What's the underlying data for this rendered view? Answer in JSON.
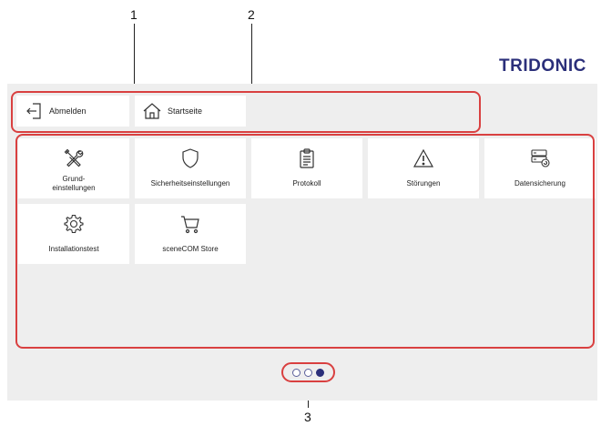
{
  "callouts": [
    "1",
    "2",
    "3"
  ],
  "brand": {
    "logo_text": "TRIDONIC",
    "color": "#2b2f7a"
  },
  "accent": "#d94040",
  "quick_actions": [
    {
      "label": "Abmelden",
      "icon": "logout-icon"
    },
    {
      "label": "Startseite",
      "icon": "home-icon"
    }
  ],
  "tiles": [
    {
      "label": "Grund-\neinstellungen",
      "icon": "wrench-screwdriver-icon"
    },
    {
      "label": "Sicherheitseinstellungen",
      "icon": "shield-icon"
    },
    {
      "label": "Protokoll",
      "icon": "clipboard-icon"
    },
    {
      "label": "Störungen",
      "icon": "warning-icon"
    },
    {
      "label": "Datensicherung",
      "icon": "server-backup-icon"
    },
    {
      "label": "Installationstest",
      "icon": "gear-icon"
    },
    {
      "label": "sceneCOM Store",
      "icon": "shopping-cart-icon"
    }
  ],
  "pagination": {
    "pages": 3,
    "current": 3
  }
}
